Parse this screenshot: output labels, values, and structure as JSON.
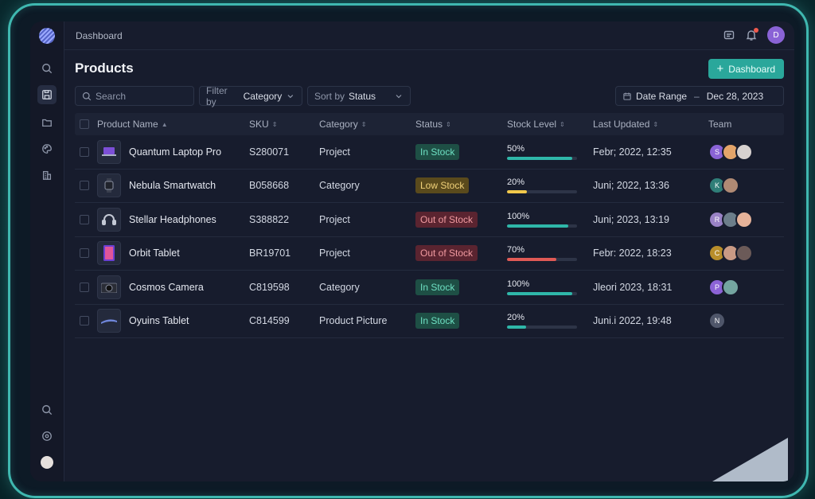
{
  "breadcrumb": "Dashboard",
  "page_title": "Products",
  "primary_button": "Dashboard",
  "search": {
    "placeholder": "Search"
  },
  "filter": {
    "prefix": "Filter by",
    "value": "Category"
  },
  "sort": {
    "prefix": "Sort by",
    "value": "Status"
  },
  "date_range": {
    "label": "Date Range",
    "separator": "–",
    "value": "Dec 28, 2023"
  },
  "user_initial": "D",
  "columns": {
    "name": "Product Name",
    "sku": "SKU",
    "category": "Category",
    "status": "Status",
    "stock": "Stock Level",
    "updated": "Last Updated",
    "team": "Team"
  },
  "rows": [
    {
      "name": "Quantum Laptop Pro",
      "sku": "S280071",
      "category": "Project",
      "status": "In Stock",
      "stock_pct": "50%",
      "stock": 0.93,
      "stock_color": "#2fb7a9",
      "updated": "Febr; 2022, 12:35",
      "team": [
        "S",
        "",
        ""
      ]
    },
    {
      "name": "Nebula Smartwatch",
      "sku": "B058668",
      "category": "Category",
      "status": "Low Stock",
      "stock_pct": "20%",
      "stock": 0.28,
      "stock_color": "#f1c84b",
      "updated": "Juni; 2022, 13:36",
      "team": [
        "K",
        ""
      ]
    },
    {
      "name": "Stellar Headphones",
      "sku": "S388822",
      "category": "Project",
      "status": "Out of Stock",
      "stock_pct": "100%",
      "stock": 0.88,
      "stock_color": "#2fb7a9",
      "updated": "Juni; 2023, 13:19",
      "team": [
        "R",
        "",
        ""
      ]
    },
    {
      "name": "Orbit Tablet",
      "sku": "BR19701",
      "category": "Project",
      "status": "Out of Stock",
      "stock_pct": "70%",
      "stock": 0.7,
      "stock_color": "#e05a55",
      "updated": "Febr: 2022, 18:23",
      "team": [
        "C",
        "",
        ""
      ]
    },
    {
      "name": "Cosmos Camera",
      "sku": "C819598",
      "category": "Category",
      "status": "In Stock",
      "stock_pct": "100%",
      "stock": 0.93,
      "stock_color": "#2fb7a9",
      "updated": "Jleori 2023, 18:31",
      "team": [
        "P",
        ""
      ]
    },
    {
      "name": "Oyuins Tablet",
      "sku": "C814599",
      "category": "Product Picture",
      "status": "In Stock",
      "stock_pct": "20%",
      "stock": 0.27,
      "stock_color": "#2fb7a9",
      "updated": "Juni.i 2022, 19:48",
      "team": [
        "N"
      ]
    }
  ],
  "colors": {
    "accent": "#2aa79b",
    "in_stock_bg": "#1e4f45",
    "in_stock_fg": "#6ee0c3",
    "low_stock_bg": "#5a4a1c",
    "low_stock_fg": "#f1d27a",
    "out_stock_bg": "#5a2430",
    "out_stock_fg": "#f19aa0"
  }
}
